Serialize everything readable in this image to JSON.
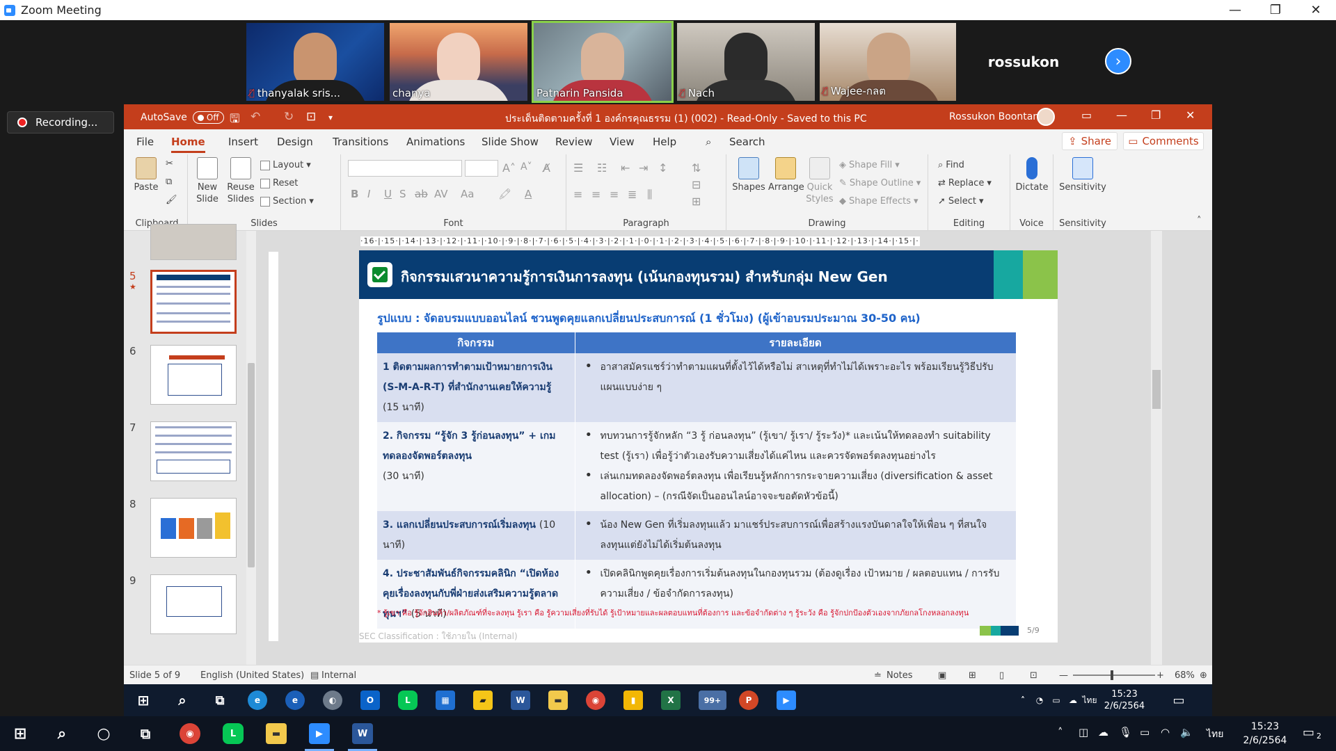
{
  "zoom": {
    "window_title": "Zoom Meeting",
    "recording_label": "Recording...",
    "participants": [
      {
        "name": "thanyalak sris...",
        "muted": true
      },
      {
        "name": "chanya",
        "muted": false
      },
      {
        "name": "Patnarin Pansida",
        "muted": false
      },
      {
        "name": "Nach",
        "muted": true
      },
      {
        "name": "Wajee-กลต",
        "muted": true
      }
    ],
    "named_tile": "rossukon"
  },
  "ppt": {
    "autosave_label": "AutoSave",
    "autosave_state": "Off",
    "doc_title": "ประเด็นติดตามครั้งที่ 1 องค์กรคุณธรรม (1) (002)  -  Read-Only  -  Saved to this PC",
    "user_name": "Rossukon Boontan",
    "tabs": [
      "File",
      "Home",
      "Insert",
      "Design",
      "Transitions",
      "Animations",
      "Slide Show",
      "Review",
      "View",
      "Help"
    ],
    "search_label": "Search",
    "share_label": "Share",
    "comments_label": "Comments",
    "ribbon": {
      "clipboard": {
        "label": "Clipboard",
        "paste": "Paste"
      },
      "slides": {
        "label": "Slides",
        "new_slide": "New Slide",
        "reuse_slides": "Reuse Slides",
        "layout": "Layout",
        "reset": "Reset",
        "section": "Section"
      },
      "font": {
        "label": "Font"
      },
      "paragraph": {
        "label": "Paragraph"
      },
      "drawing": {
        "label": "Drawing",
        "shapes": "Shapes",
        "arrange": "Arrange",
        "quick_styles": "Quick Styles",
        "shape_fill": "Shape Fill",
        "shape_outline": "Shape Outline",
        "shape_effects": "Shape Effects"
      },
      "editing": {
        "label": "Editing",
        "find": "Find",
        "replace": "Replace",
        "select": "Select"
      },
      "voice": {
        "label": "Voice",
        "dictate": "Dictate"
      },
      "sensitivity": {
        "label": "Sensitivity",
        "sensitivity": "Sensitivity"
      }
    },
    "thumbnails": [
      "5",
      "6",
      "7",
      "8",
      "9"
    ],
    "ruler_text": "·16·|·15·|·14·|·13·|·12·|·11·|·10·|·9·|·8·|·7·|·6·|·5·|·4·|·3·|·2·|·1·|·0·|·1·|·2·|·3·|·4·|·5·|·6·|·7·|·8·|·9·|·10·|·11·|·12·|·13·|·14·|·15·|·16·",
    "slide": {
      "title": "กิจกรรมเสวนาความรู้การเงินการลงทุน (เน้นกองทุนรวม) สำหรับกลุ่ม New Gen",
      "format": "รูปแบบ : จัดอบรมแบบออนไลน์ ชวนพูดคุยแลกเปลี่ยนประสบการณ์ (1 ชั่วโมง) (ผู้เข้าอบรมประมาณ 30-50 คน)",
      "col_activity": "กิจกรรม",
      "col_detail": "รายละเอียด",
      "rows": [
        {
          "activity": "1 ติดตามผลการทำตามเป้าหมายการเงิน (S-M-A-R-T) ที่สำนักงานเคยให้ความรู้",
          "duration": "(15 นาที)",
          "details": [
            "อาสาสมัครแชร์ว่าทำตามแผนที่ตั้งไว้ได้หรือไม่ สาเหตุที่ทำไม่ได้เพราะอะไร พร้อมเรียนรู้วิธีปรับแผนแบบง่าย ๆ"
          ]
        },
        {
          "activity": "2. กิจกรรม “รู้จัก 3 รู้ก่อนลงทุน” + เกมทดลองจัดพอร์ตลงทุน",
          "duration": "(30 นาที)",
          "details": [
            "ทบทวนการรู้จักหลัก “3 รู้ ก่อนลงทุน” (รู้เขา/ รู้เรา/ รู้ระวัง)* และเน้นให้ทดลองทำ suitability test (รู้เรา) เพื่อรู้ว่าตัวเองรับความเสี่ยงได้แค่ไหน และควรจัดพอร์ตลงทุนอย่างไร",
            "เล่นเกมทดลองจัดพอร์ตลงทุน เพื่อเรียนรู้หลักการกระจายความเสี่ยง (diversification & asset allocation) – (กรณีจัดเป็นออนไลน์อาจจะขอตัดหัวข้อนี้)"
          ]
        },
        {
          "activity": "3. แลกเปลี่ยนประสบการณ์เริ่มลงทุน",
          "duration": "(10 นาที)",
          "details": [
            "น้อง New Gen ที่เริ่มลงทุนแล้ว มาแชร์ประสบการณ์เพื่อสร้างแรงบันดาลใจให้เพื่อน ๆ ที่สนใจลงทุนแต่ยังไม่ได้เริ่มต้นลงทุน"
          ]
        },
        {
          "activity": "4. ประชาสัมพันธ์กิจกรรมคลินิก “เปิดห้องคุยเรื่องลงทุนกับพี่ฝ่ายส่งเสริมความรู้ตลาดทุนฯ”",
          "duration": "(5 นาที)",
          "details": [
            "เปิดคลินิกพูดคุยเรื่องการเริ่มต้นลงทุนในกองทุนรวม (ต้องดูเรื่อง เป้าหมาย / ผลตอบแทน / การรับความเสี่ยง / ข้อจำกัดการลงทุน)"
          ]
        }
      ],
      "footnote": "* รู้เขา คือ รู้จักสินค้า/ผลิตภัณฑ์ที่จะลงทุน รู้เรา คือ รู้ความเสี่ยงที่รับได้ รู้เป้าหมายและผลตอบแทนที่ต้องการ และข้อจำกัดต่าง ๆ รู้ระวัง คือ รู้จักปกป้องตัวเองจากภัยกลโกงหลอกลงทุน",
      "classification": "SEC Classification : ใช้ภายใน (Internal)",
      "page": "5/9"
    },
    "status": {
      "slide_of": "Slide 5 of 9",
      "language": "English (United States)",
      "sensitivity": "Internal",
      "notes": "Notes",
      "zoom": "68%"
    }
  },
  "inner_taskbar": {
    "badge": "99+",
    "lang": "ไทย",
    "time": "15:23",
    "date": "2/6/2564"
  },
  "outer_taskbar": {
    "lang": "ไทย",
    "time": "15:23",
    "date": "2/6/2564",
    "notifications": "2"
  }
}
